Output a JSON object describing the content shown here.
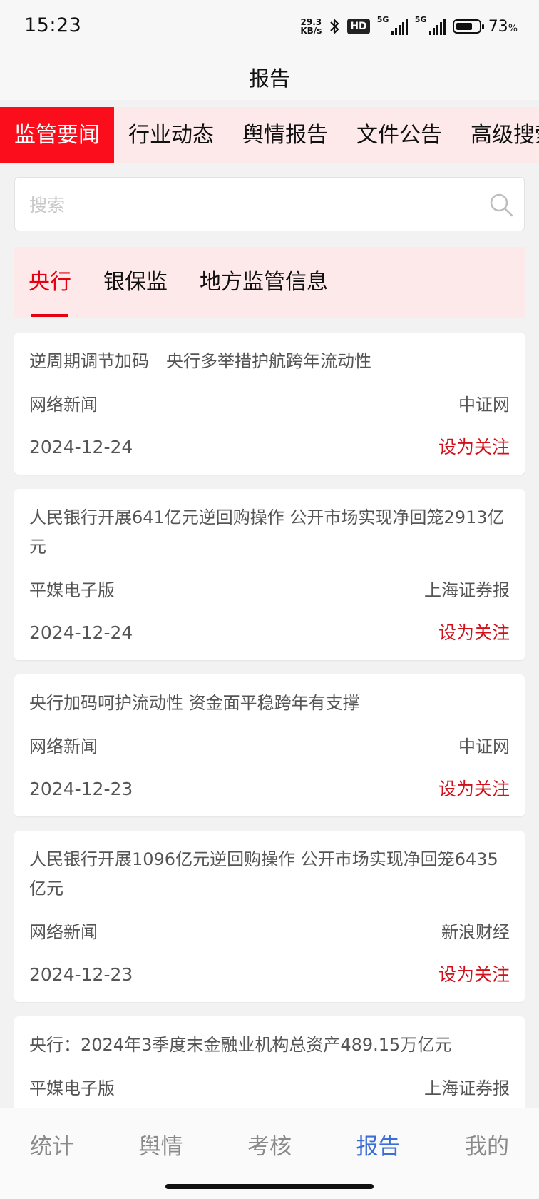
{
  "status_bar": {
    "time": "15:23",
    "net_speed_value": "29.3",
    "net_speed_unit": "KB/s",
    "hd_label": "HD",
    "signal_label_1": "5G",
    "signal_label_2": "5G",
    "battery_percent": "73",
    "battery_percent_sign": "%",
    "battery_level": 0.73
  },
  "header": {
    "title": "报告"
  },
  "top_tabs": [
    "监管要闻",
    "行业动态",
    "舆情报告",
    "文件公告",
    "高级搜索"
  ],
  "search": {
    "placeholder": "搜索",
    "value": ""
  },
  "sub_tabs": [
    "央行",
    "银保监",
    "地方监管信息"
  ],
  "news": [
    {
      "title": "逆周期调节加码　央行多举措护航跨年流动性",
      "type": "网络新闻",
      "source": "中证网",
      "date": "2024-12-24",
      "action": "设为关注"
    },
    {
      "title": "人民银行开展641亿元逆回购操作 公开市场实现净回笼2913亿元",
      "type": "平媒电子版",
      "source": "上海证券报",
      "date": "2024-12-24",
      "action": "设为关注"
    },
    {
      "title": "央行加码呵护流动性 资金面平稳跨年有支撑",
      "type": "网络新闻",
      "source": "中证网",
      "date": "2024-12-23",
      "action": "设为关注"
    },
    {
      "title": "人民银行开展1096亿元逆回购操作 公开市场实现净回笼6435亿元",
      "type": "网络新闻",
      "source": "新浪财经",
      "date": "2024-12-23",
      "action": "设为关注"
    },
    {
      "title": "央行：2024年3季度末金融业机构总资产489.15万亿元",
      "type": "平媒电子版",
      "source": "上海证券报",
      "date": "",
      "action": ""
    }
  ],
  "bottom_nav": [
    "统计",
    "舆情",
    "考核",
    "报告",
    "我的"
  ],
  "colors": {
    "brand_red": "#fb0d1b",
    "accent_red": "#e60012",
    "tab_bg_pink": "#fde9ea",
    "nav_active_blue": "#3b6fd6"
  }
}
